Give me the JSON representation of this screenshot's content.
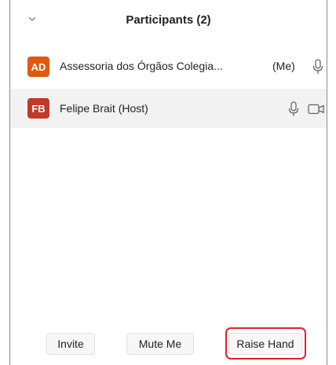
{
  "header": {
    "title": "Participants (2)",
    "collapse_icon": "chevron-down-icon"
  },
  "participants": [
    {
      "initials": "AD",
      "name": "Assessoria dos Órgãos Colegia...",
      "tag": "(Me)",
      "avatar_color": "#de5a10",
      "icons": [
        "microphone-icon"
      ]
    },
    {
      "initials": "FB",
      "name": "Felipe Brait (Host)",
      "tag": "",
      "avatar_color": "#c0392b",
      "icons": [
        "microphone-icon",
        "camera-icon"
      ]
    }
  ],
  "footer": {
    "invite_label": "Invite",
    "mute_label": "Mute Me",
    "raise_label": "Raise Hand",
    "highlight_color": "#e0202a"
  }
}
